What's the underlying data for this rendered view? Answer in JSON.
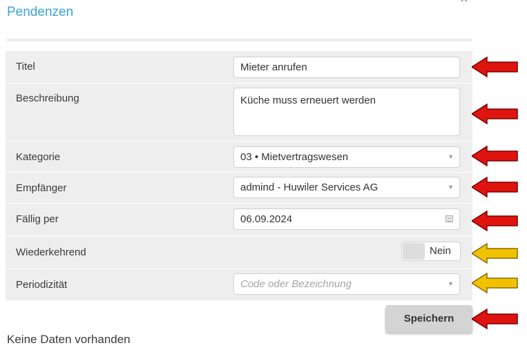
{
  "dialog": {
    "title": "Pendenzen",
    "close_label": "×"
  },
  "form": {
    "titel": {
      "label": "Titel",
      "value": "Mieter anrufen"
    },
    "beschreibung": {
      "label": "Beschreibung",
      "value": "Küche muss erneuert werden"
    },
    "kategorie": {
      "label": "Kategorie",
      "value": "03 • Mietvertragswesen"
    },
    "empfaenger": {
      "label": "Empfänger",
      "value": "admind - Huwiler Services AG"
    },
    "faellig": {
      "label": "Fällig per",
      "value": "06.09.2024"
    },
    "wiederkehrend": {
      "label": "Wiederkehrend",
      "value": "Nein"
    },
    "periodizitaet": {
      "label": "Periodizität",
      "placeholder": "Code oder Bezeichnung"
    }
  },
  "actions": {
    "save_label": "Speichern"
  },
  "empty_message": "Keine Daten vorhanden",
  "colors": {
    "title": "#38a3d9",
    "panel": "#eeeeee",
    "arrow_red": "#e0140f",
    "arrow_yellow": "#f2c200"
  }
}
